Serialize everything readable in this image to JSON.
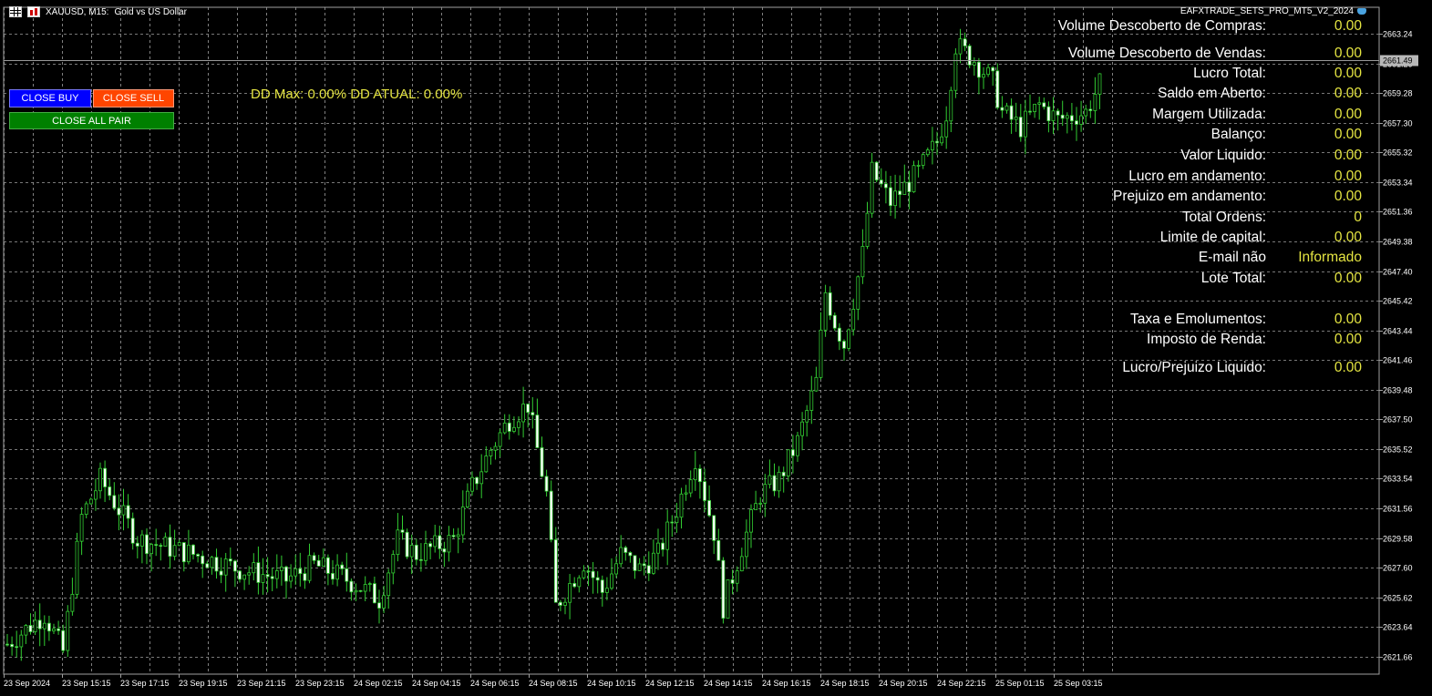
{
  "header": {
    "symbol": "XAUUSD, M15:",
    "description": "Gold vs US Dollar",
    "ea_name": "EAFXTRADE_SETS_PRO_MT5_V2_2024",
    "icons": [
      "chart-grid-icon",
      "bars-icon",
      "graduation-hat-icon"
    ]
  },
  "buttons": {
    "close_buy": "CLOSE BUY",
    "close_sell": "CLOSE SELL",
    "close_all": "CLOSE ALL PAIR"
  },
  "dd_text": "DD Max: 0.00% DD ATUAL: 0.00%",
  "stats": [
    {
      "label": "Volume Descoberto de Compras:",
      "value": "0.00"
    },
    {
      "label": "Volume Descoberto de Vendas:",
      "value": "0.00"
    },
    {
      "label": "Lucro Total:",
      "value": "0.00"
    },
    {
      "label": "Saldo em Aberto:",
      "value": "0.00"
    },
    {
      "label": "Margem Utilizada:",
      "value": "0.00"
    },
    {
      "label": "Balanço:",
      "value": "0.00"
    },
    {
      "label": "Valor Liquido:",
      "value": "0.00"
    },
    {
      "label": "Lucro em andamento:",
      "value": "0.00"
    },
    {
      "label": "Prejuizo em andamento:",
      "value": "0.00"
    },
    {
      "label": "Total Ordens:",
      "value": "0"
    },
    {
      "label": "Limite de capital:",
      "value": "0.00"
    },
    {
      "label": "E-mail não",
      "value": "Informado"
    },
    {
      "label": "Lote Total:",
      "value": "0.00"
    },
    {
      "label": "Taxa e Emolumentos:",
      "value": "0.00"
    },
    {
      "label": "Imposto de Renda:",
      "value": "0.00"
    },
    {
      "label": "Lucro/Prejuizo Liquido:",
      "value": "0.00"
    }
  ],
  "colors": {
    "background": "#000000",
    "grid": "#a0a0a0",
    "candle": "#32cd32",
    "bull_body": "#000000",
    "bear_body": "#ffffff",
    "stats_value": "#e5e542"
  },
  "chart_data": {
    "type": "candlestick",
    "grid": true,
    "current_price": 2661.49,
    "ylim": [
      2620.5,
      2665.0
    ],
    "y_ticks": [
      "2663.24",
      "2661.26",
      "2659.28",
      "2657.30",
      "2655.32",
      "2653.34",
      "2651.36",
      "2649.38",
      "2647.40",
      "2645.42",
      "2643.44",
      "2641.46",
      "2639.48",
      "2637.50",
      "2635.52",
      "2633.54",
      "2631.56",
      "2629.58",
      "2627.60",
      "2625.62",
      "2623.64",
      "2621.66"
    ],
    "x_ticks": [
      "23 Sep 2024",
      "23 Sep 15:15",
      "23 Sep 17:15",
      "23 Sep 19:15",
      "23 Sep 21:15",
      "23 Sep 23:15",
      "24 Sep 02:15",
      "24 Sep 04:15",
      "24 Sep 06:15",
      "24 Sep 08:15",
      "24 Sep 10:15",
      "24 Sep 12:15",
      "24 Sep 14:15",
      "24 Sep 16:15",
      "24 Sep 18:15",
      "24 Sep 20:15",
      "24 Sep 22:15",
      "25 Sep 01:15",
      "25 Sep 03:15"
    ],
    "close_path": [
      [
        0,
        2622.5
      ],
      [
        4,
        2624.5
      ],
      [
        6,
        2622.0
      ],
      [
        8,
        2631.0
      ],
      [
        10,
        2633.5
      ],
      [
        12,
        2631.5
      ],
      [
        14,
        2629.5
      ],
      [
        20,
        2628.5
      ],
      [
        25,
        2627.5
      ],
      [
        30,
        2626.8
      ],
      [
        33,
        2627.8
      ],
      [
        36,
        2627.0
      ],
      [
        38,
        2626.3
      ],
      [
        40,
        2625.5
      ],
      [
        42,
        2629.5
      ],
      [
        44,
        2628.5
      ],
      [
        48,
        2629.5
      ],
      [
        50,
        2633.0
      ],
      [
        52,
        2635.5
      ],
      [
        54,
        2637.5
      ],
      [
        56,
        2638.5
      ],
      [
        58,
        2632.5
      ],
      [
        59,
        2625.0
      ],
      [
        62,
        2628.0
      ],
      [
        64,
        2626.0
      ],
      [
        66,
        2628.5
      ],
      [
        68,
        2627.5
      ],
      [
        70,
        2628.5
      ],
      [
        72,
        2631.5
      ],
      [
        74,
        2635.0
      ],
      [
        76,
        2630.0
      ],
      [
        77,
        2625.0
      ],
      [
        79,
        2629.0
      ],
      [
        81,
        2632.5
      ],
      [
        83,
        2633.5
      ],
      [
        85,
        2636.0
      ],
      [
        87,
        2640.0
      ],
      [
        88,
        2646.0
      ],
      [
        89,
        2644.0
      ],
      [
        90,
        2642.5
      ],
      [
        92,
        2648.5
      ],
      [
        93,
        2654.0
      ],
      [
        95,
        2652.0
      ],
      [
        98,
        2654.0
      ],
      [
        100,
        2656.0
      ],
      [
        101,
        2658.0
      ],
      [
        102,
        2662.5
      ],
      [
        104,
        2661.5
      ],
      [
        106,
        2660.0
      ],
      [
        107,
        2658.0
      ],
      [
        109,
        2657.0
      ],
      [
        111,
        2658.5
      ],
      [
        113,
        2657.5
      ],
      [
        116,
        2658.0
      ],
      [
        118,
        2660.5
      ],
      [
        119,
        2657.5
      ],
      [
        120,
        2660.5
      ],
      [
        121,
        2661.5
      ]
    ]
  }
}
